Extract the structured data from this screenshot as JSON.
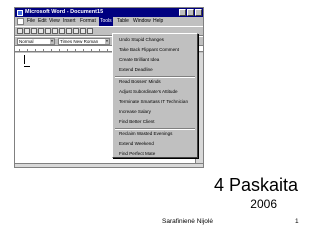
{
  "window": {
    "title": "Microsoft Word - Document15"
  },
  "menubar": {
    "items": [
      "File",
      "Edit",
      "View",
      "Insert",
      "Format",
      "Tools",
      "Table",
      "Window",
      "Help"
    ],
    "active": "Tools"
  },
  "toolbar": {
    "style_value": "Normal",
    "font_value": "Times New Roman"
  },
  "tools_menu": {
    "items": [
      "Undo Stupid Changes",
      "Take Back Flippant Comment",
      "Create Brilliant Idea",
      "Extend Deadline",
      "Read Bosses' Minds",
      "Adjust Subordinate's Attitude",
      "Terminate Smartass IT Technician",
      "Increase Salary",
      "Find Better Client",
      "Reclaim Wasted Evenings",
      "Extend Weekend",
      "Find Perfect Mate"
    ]
  },
  "slide": {
    "title": "4 Paskaita",
    "year": "2006",
    "footer_author": "Sarafinienė Nijolė",
    "page_number": "1"
  },
  "colors": {
    "title_bar": "#000080",
    "chrome": "#c0c0c0"
  }
}
